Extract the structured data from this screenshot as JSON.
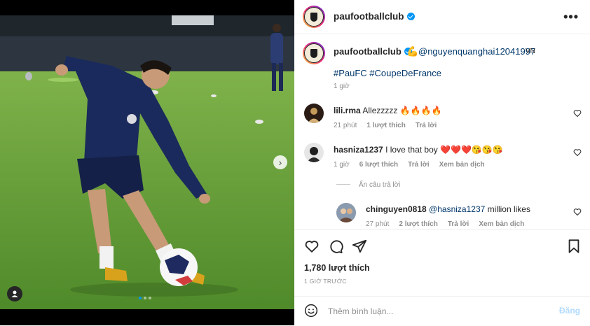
{
  "post": {
    "username": "paufootballclub",
    "more_label": "•••"
  },
  "caption": {
    "username": "paufootballclub",
    "emoji": "💪",
    "mention": "@nguyenquanghai12041997",
    "country": "VN",
    "hashtags": "#PauFC #CoupeDeFrance",
    "time": "1 giờ"
  },
  "comments": [
    {
      "username": "lili.rma",
      "text": "Allezzzzz 🔥🔥🔥🔥",
      "time": "21 phút",
      "likes": "1 lượt thích",
      "reply": "Trả lời"
    },
    {
      "username": "hasniza1237",
      "text": "I love that boy ❤️❤️❤️😘😘😘",
      "time": "1 giờ",
      "likes": "6 lượt thích",
      "reply": "Trả lời",
      "translate": "Xem bản dịch"
    }
  ],
  "hide_replies": "Ẩn câu trả lời",
  "reply": {
    "username": "chinguyen0818",
    "mention": "@hasniza1237",
    "text": " million likes",
    "time": "27 phút",
    "likes": "2 lượt thích",
    "reply": "Trả lời",
    "translate": "Xem bản dịch"
  },
  "likes_count": "1,780 lượt thích",
  "posted_ago": "1 GIỜ TRƯỚC",
  "comment_box": {
    "placeholder": "Thêm bình luận...",
    "post_label": "Đăng"
  },
  "colors": {
    "accent": "#0095f6",
    "link": "#00376b",
    "muted": "#8e8e8e",
    "post_disabled": "#b3dbff"
  }
}
